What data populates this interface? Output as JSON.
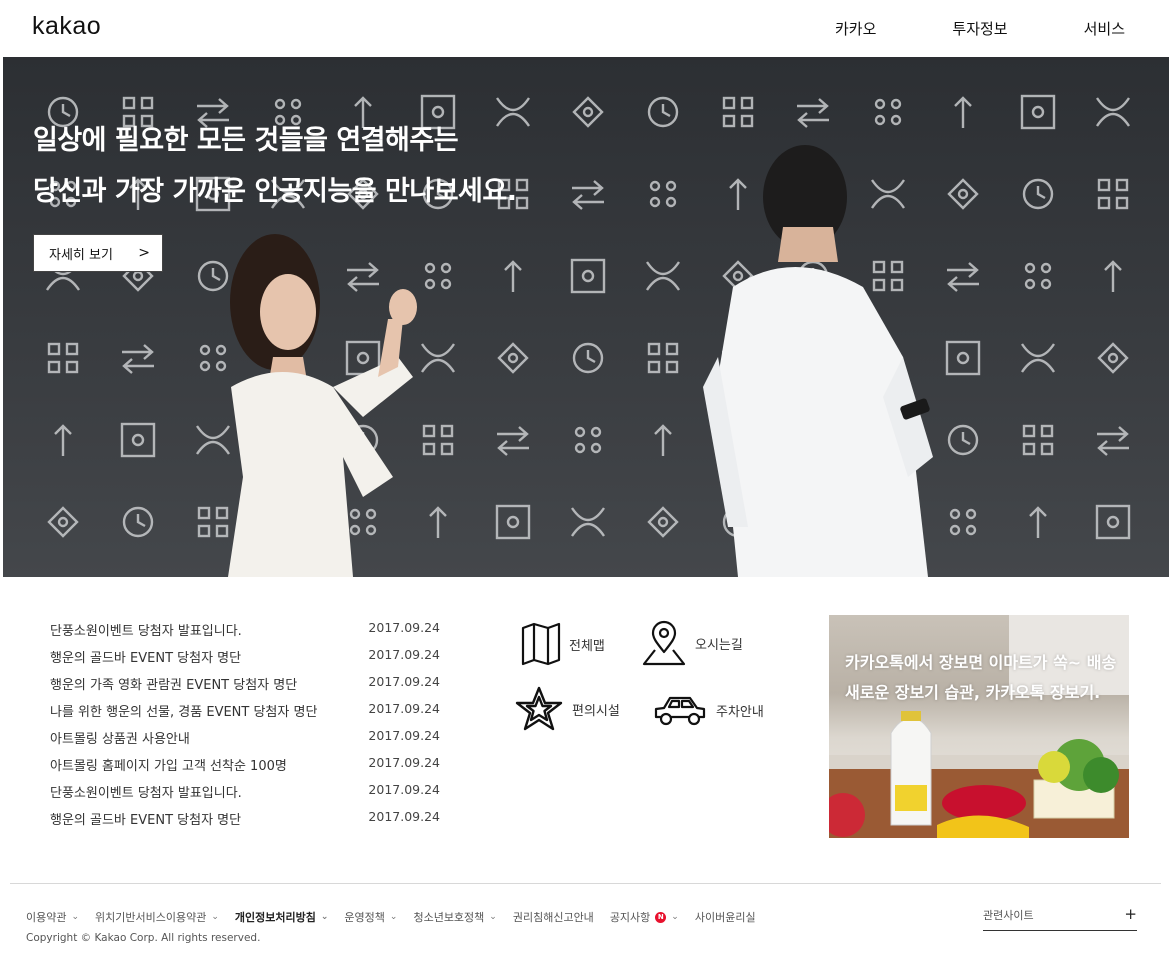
{
  "header": {
    "logo": "kakao",
    "nav": [
      "카카오",
      "투자정보",
      "서비스"
    ]
  },
  "hero": {
    "title_line1": "일상에 필요한 모든 것들을 연결해주는",
    "title_line2": "당신과 가장 가까운 인공지능을 만나보세요.",
    "more_label": "자세히 보기",
    "more_arrow": ">"
  },
  "notices": [
    {
      "title": "단풍소원이벤트 당첨자 발표입니다.",
      "date": "2017.09.24"
    },
    {
      "title": "행운의 골드바 EVENT 당첨자 명단",
      "date": "2017.09.24"
    },
    {
      "title": "행운의 가족 영화 관람권 EVENT 당첨자 명단",
      "date": "2017.09.24"
    },
    {
      "title": "나를 위한 행운의 선물, 경품 EVENT 당첨자 명단",
      "date": "2017.09.24"
    },
    {
      "title": "아트몰링 상품권 사용안내",
      "date": "2017.09.24"
    },
    {
      "title": "아트몰링 홈페이지 가입 고객 선착순 100명",
      "date": "2017.09.24"
    },
    {
      "title": "단풍소원이벤트 당첨자 발표입니다.",
      "date": "2017.09.24"
    },
    {
      "title": "행운의 골드바 EVENT 당첨자 명단",
      "date": "2017.09.24"
    }
  ],
  "quick_links": {
    "map": "전체맵",
    "directions": "오시는길",
    "facilities": "편의시설",
    "parking": "주차안내"
  },
  "promo": {
    "line1": "카카오톡에서 장보면 이마트가 쏙~ 배송",
    "line2": "새로운 장보기 습관, 카카오톡 장보기."
  },
  "footer": {
    "links": [
      {
        "label": "이용약관",
        "chevron": true
      },
      {
        "label": "위치기반서비스이용약관",
        "chevron": true
      },
      {
        "label": "개인정보처리방침",
        "chevron": true,
        "bold": true
      },
      {
        "label": "운영정책",
        "chevron": true
      },
      {
        "label": "청소년보호정책",
        "chevron": true
      },
      {
        "label": "권리침해신고안내",
        "chevron": false
      },
      {
        "label": "공지사항",
        "chevron": true,
        "badge": "N"
      },
      {
        "label": "사이버윤리실",
        "chevron": false
      }
    ],
    "copyright": "Copyright © Kakao Corp. All rights reserved.",
    "related_sites": "관련사이트",
    "related_plus": "+"
  },
  "colors": {
    "hero_bg": "#33363a",
    "badge_red": "#e8112d",
    "text_dark": "#222222"
  }
}
